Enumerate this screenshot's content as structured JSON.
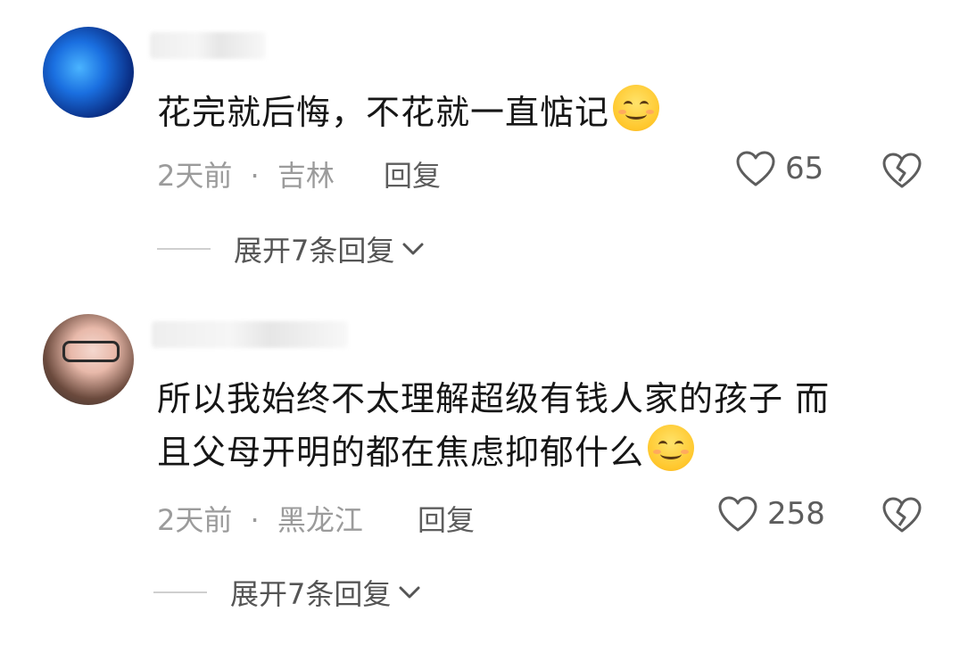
{
  "comments": [
    {
      "text": "花完就后悔，不花就一直惦记",
      "time": "2天前",
      "separator": "·",
      "location": "吉林",
      "reply_label": "回复",
      "likes": "65",
      "expand_label": "展开7条回复"
    },
    {
      "text_line1": "所以我始终不太理解超级有钱人家的孩子 而",
      "text_line2": "且父母开明的都在焦虑抑郁什么",
      "time": "2天前",
      "separator": "·",
      "location": "黑龙江",
      "reply_label": "回复",
      "likes": "258",
      "expand_label": "展开7条回复"
    }
  ],
  "icons": {
    "like": "heart-outline-icon",
    "dislike": "broken-heart-icon",
    "expand": "chevron-down-icon",
    "emoji": "smiling-face-emoji"
  },
  "colors": {
    "meta": "#9b9b9b",
    "action": "#5d5d5d",
    "text": "#161616"
  }
}
